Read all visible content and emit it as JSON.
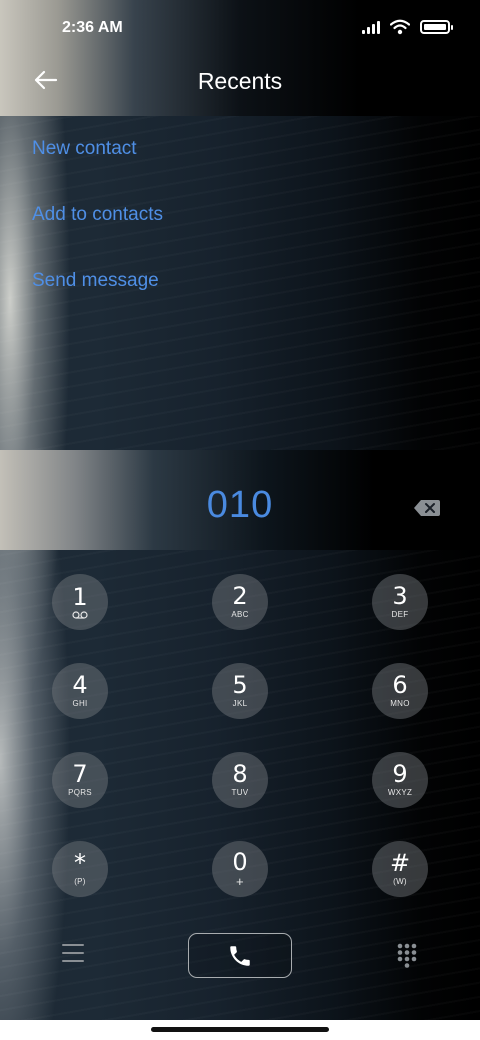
{
  "status_bar": {
    "time": "2:36 AM",
    "icons": [
      "signal-icon",
      "wifi-icon",
      "battery-icon"
    ]
  },
  "header": {
    "back_icon": "arrow-left-icon",
    "title": "Recents"
  },
  "menu": {
    "items": [
      {
        "label": "New contact"
      },
      {
        "label": "Add to contacts"
      },
      {
        "label": "Send message"
      }
    ]
  },
  "display": {
    "number": "010",
    "backspace_icon": "backspace-icon"
  },
  "keypad": {
    "keys": [
      {
        "digit": "1",
        "sub": "voicemail-icon"
      },
      {
        "digit": "2",
        "sub": "ABC"
      },
      {
        "digit": "3",
        "sub": "DEF"
      },
      {
        "digit": "4",
        "sub": "GHI"
      },
      {
        "digit": "5",
        "sub": "JKL"
      },
      {
        "digit": "6",
        "sub": "MNO"
      },
      {
        "digit": "7",
        "sub": "PQRS"
      },
      {
        "digit": "8",
        "sub": "TUV"
      },
      {
        "digit": "9",
        "sub": "WXYZ"
      },
      {
        "digit": "*",
        "sub": "(P)"
      },
      {
        "digit": "0",
        "sub": "+"
      },
      {
        "digit": "#",
        "sub": "(W)"
      }
    ]
  },
  "bottom_bar": {
    "menu_icon": "hamburger-icon",
    "call_icon": "phone-icon",
    "dialpad_icon": "dialpad-icon"
  },
  "colors": {
    "accent": "#4f8fe6",
    "key_background": "#6b6f73"
  }
}
